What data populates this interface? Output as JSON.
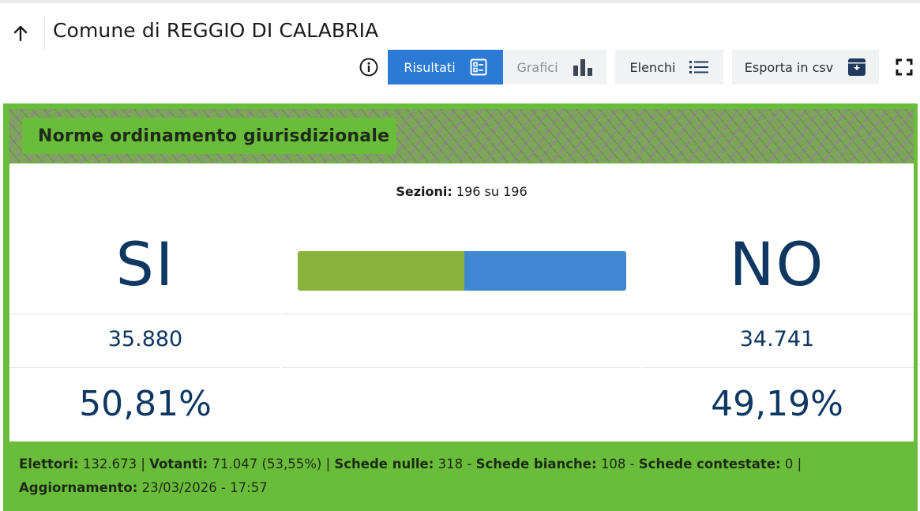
{
  "header": {
    "title": "Comune di REGGIO DI CALABRIA"
  },
  "toolbar": {
    "risultati_label": "Risultati",
    "grafici_label": "Grafici",
    "elenchi_label": "Elenchi",
    "csv_label": "Esporta in csv"
  },
  "referendum": {
    "title": "Norme ordinamento giurisdizionale",
    "sezioni_label": "Sezioni:",
    "sezioni_value": "196 su 196",
    "si_label": "SI",
    "no_label": "NO",
    "si_votes": "35.880",
    "no_votes": "34.741",
    "si_percent": "50,81%",
    "no_percent": "49,19%",
    "si_fraction": 0.5081,
    "no_fraction": 0.4919
  },
  "footer": {
    "elettori_label": "Elettori:",
    "elettori_value": "132.673",
    "votanti_label": "Votanti:",
    "votanti_value": "71.047 (53,55%)",
    "nulle_label": "Schede nulle:",
    "nulle_value": "318",
    "bianche_label": "Schede bianche:",
    "bianche_value": "108",
    "contestate_label": "Schede contestate:",
    "contestate_value": "0",
    "aggiornamento_label": "Aggiornamento:",
    "aggiornamento_value": "23/03/2026 - 17:57"
  },
  "colors": {
    "primary": "#2b7bd6",
    "green": "#6abd3a",
    "si_bar": "#8ab33e",
    "no_bar": "#3f88d1",
    "text_dark_blue": "#0e3762"
  },
  "icons": [
    "arrow-up-icon",
    "info-icon",
    "list-view-icon",
    "bar-chart-icon",
    "list-icon",
    "download-box-icon",
    "fullscreen-icon"
  ]
}
